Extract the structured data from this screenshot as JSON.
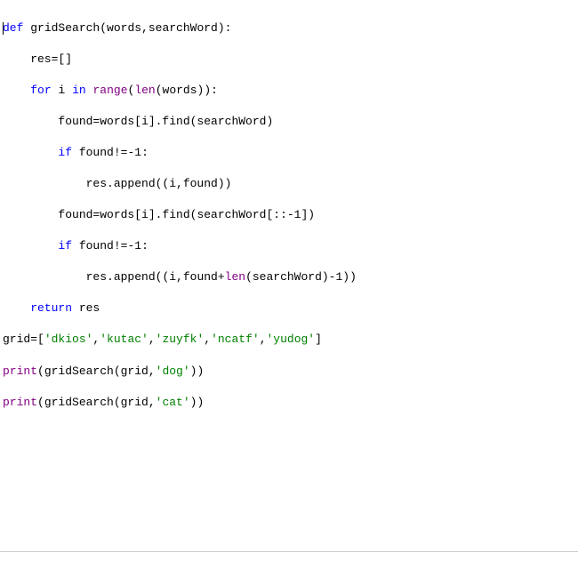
{
  "code": {
    "line1": {
      "def": "def",
      "funcname": "gridSearch",
      "params": "(words,searchWord):"
    },
    "line2": "    res=[]",
    "line3": {
      "indent": "    ",
      "for": "for",
      "sp1": " ",
      "var": "i",
      "sp2": " ",
      "in": "in",
      "sp3": " ",
      "range": "range",
      "rest": "(",
      "len": "len",
      "rest2": "(words)):"
    },
    "line4": "        found=words[i].find(searchWord)",
    "line5": {
      "indent": "        ",
      "if": "if",
      "rest": " found!=-",
      "num": "1",
      "colon": ":"
    },
    "line6": "            res.append((i,found))",
    "line7": {
      "indent": "        ",
      "text1": "found=words[i].find(searchWord[::-",
      "num": "1",
      "text2": "])"
    },
    "line8": {
      "indent": "        ",
      "if": "if",
      "rest": " found!=-",
      "num": "1",
      "colon": ":"
    },
    "line9": {
      "indent": "            ",
      "text1": "res.append((i,found+",
      "len": "len",
      "text2": "(searchWord)-",
      "num": "1",
      "text3": "))"
    },
    "line10": {
      "indent": "    ",
      "return": "return",
      "rest": " res"
    },
    "line11": {
      "text1": "grid=[",
      "s1": "'dkios'",
      "c1": ",",
      "s2": "'kutac'",
      "c2": ",",
      "s3": "'zuyfk'",
      "c3": ",",
      "s4": "'ncatf'",
      "c4": ",",
      "s5": "'yudog'",
      "text2": "]"
    },
    "line12": {
      "print": "print",
      "text1": "(gridSearch(grid,",
      "str": "'dog'",
      "text2": "))"
    },
    "line13": {
      "print": "print",
      "text1": "(gridSearch(grid,",
      "str": "'cat'",
      "text2": "))"
    }
  },
  "status": ""
}
